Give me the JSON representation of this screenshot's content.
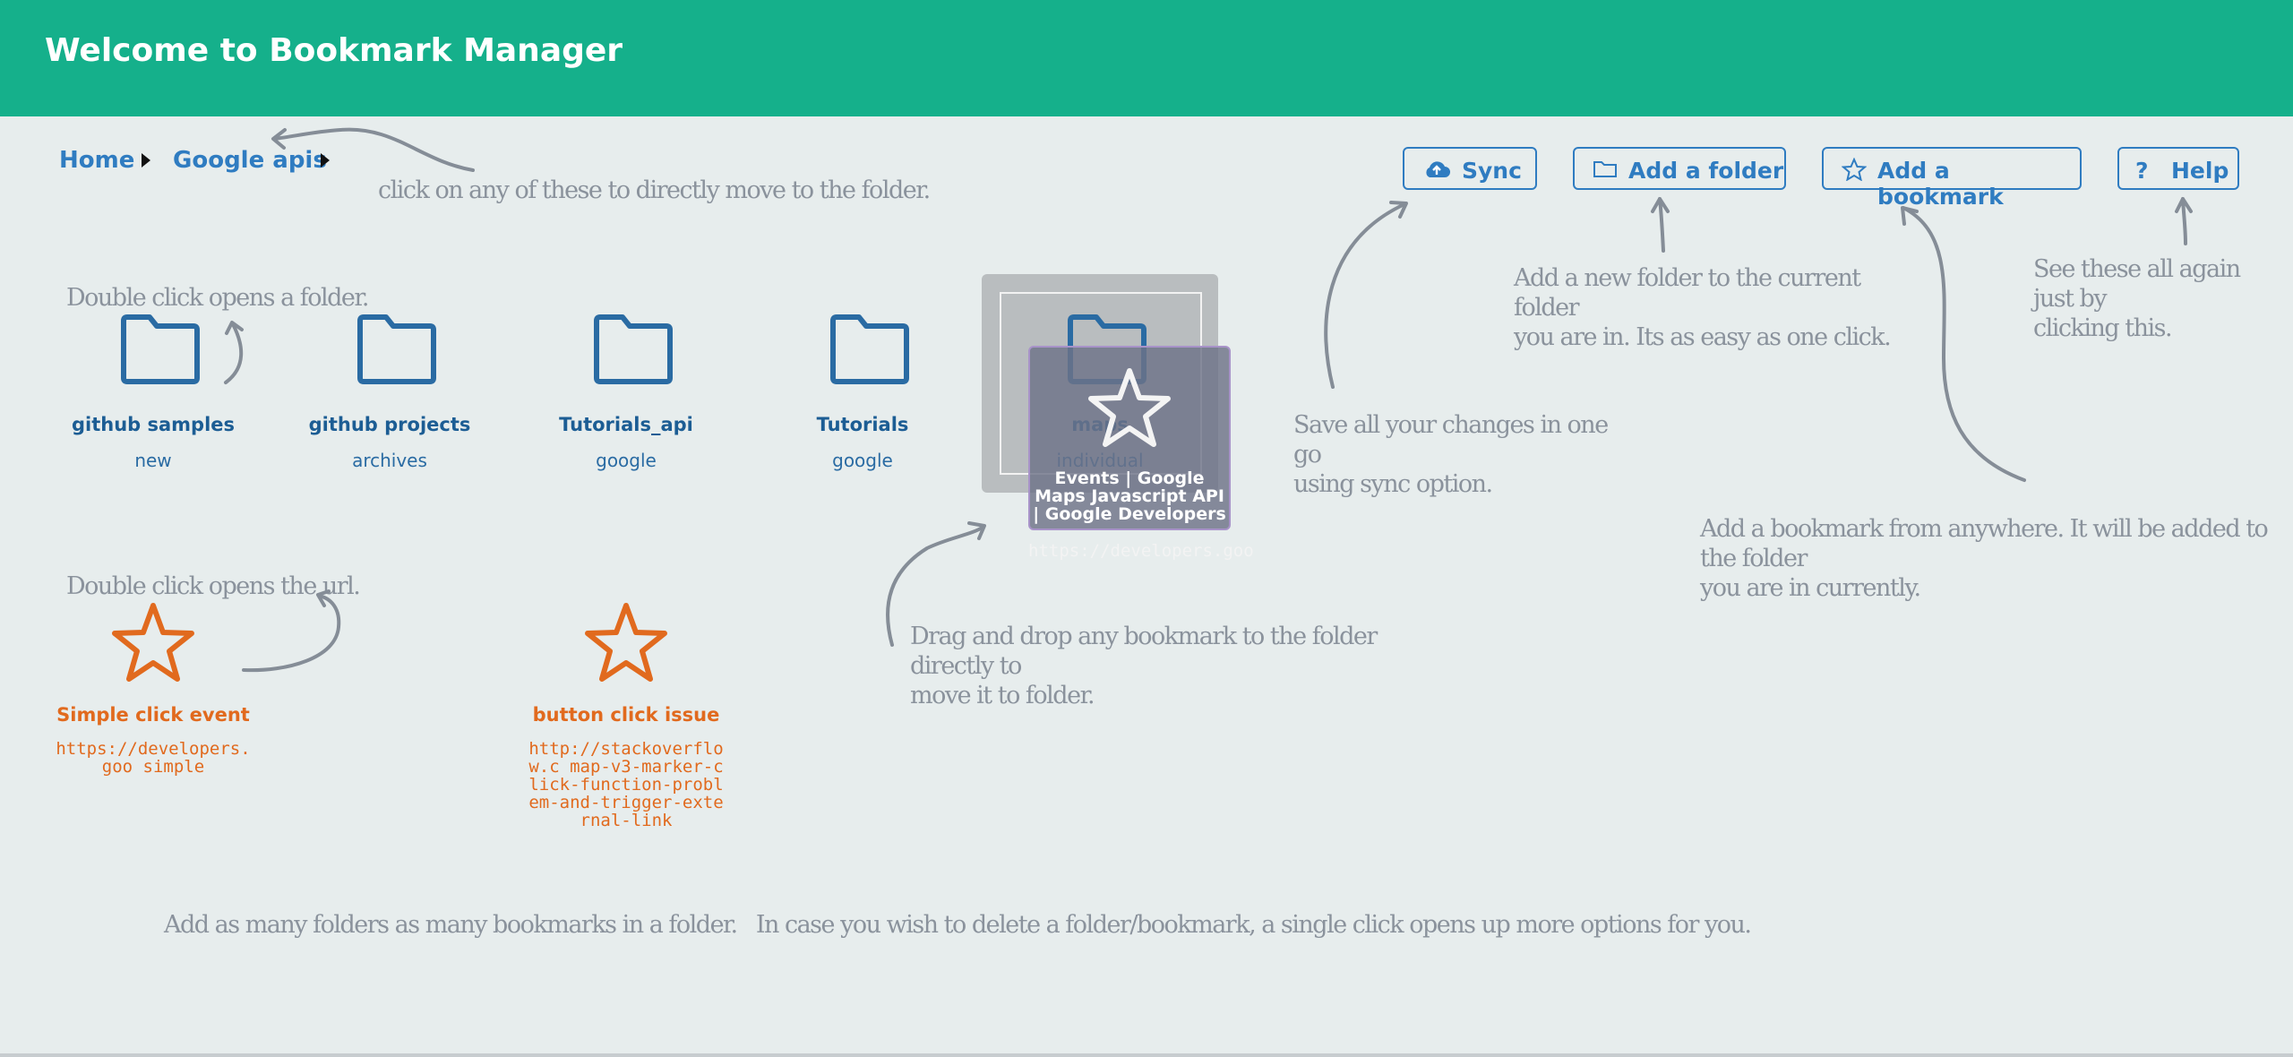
{
  "header": {
    "title": "Welcome to Bookmark Manager"
  },
  "breadcrumb": [
    {
      "label": "Home"
    },
    {
      "label": "Google apis"
    }
  ],
  "toolbar": {
    "sync_label": "Sync",
    "add_folder_label": "Add a folder",
    "add_bookmark_label": "Add a bookmark",
    "help_label": "Help",
    "help_icon": "?"
  },
  "notes": {
    "breadcrumb_hint": "click on any of these to directly move to the folder.",
    "folder_hint": "Double click opens a folder.",
    "url_hint": "Double click opens the url.",
    "drag_hint": "Drag and drop any bookmark to the folder directly to\nmove it to folder.",
    "sync_hint": "Save all your changes in one go\nusing sync option.",
    "add_folder_hint": "Add a new folder to the current folder\nyou are in. Its as easy as one click.",
    "add_bookmark_hint": "Add a bookmark from anywhere. It will be added to the folder\nyou are in currently.",
    "help_hint": "See these all again just by\nclicking this.",
    "bottom_hint": "Add as many folders as many bookmarks in a folder.   In case you wish to delete a folder/bookmark, a single click opens up more options for you."
  },
  "folders": [
    {
      "title": "github samples",
      "subtitle": "new"
    },
    {
      "title": "github projects",
      "subtitle": "archives"
    },
    {
      "title": "Tutorials_api",
      "subtitle": "google"
    },
    {
      "title": "Tutorials",
      "subtitle": "google"
    },
    {
      "title": "maps",
      "subtitle": "individual"
    }
  ],
  "bookmarks": [
    {
      "title": "Simple click event",
      "url": "https://developers.goo simple"
    },
    {
      "title": "button click issue",
      "url": "http://stackoverflow.c map-v3-marker-click-function-problem-and-trigger-external-link"
    }
  ],
  "drag_ghost": {
    "title": "Events | Google Maps Javascript API | Google Developers",
    "url": "https://developers.goo"
  },
  "colors": {
    "header": "#15b08b",
    "background": "#e7eded",
    "accent": "#2f7cc1",
    "folder": "#2a6ba3",
    "bookmark": "#e16a1e",
    "annotation": "#8a929c"
  },
  "icons": {
    "sync": "cloud-upload-icon",
    "add_folder": "folder-outline-icon",
    "add_bookmark": "star-outline-icon",
    "help": "question-icon",
    "breadcrumb_sep": "caret-right-icon"
  }
}
